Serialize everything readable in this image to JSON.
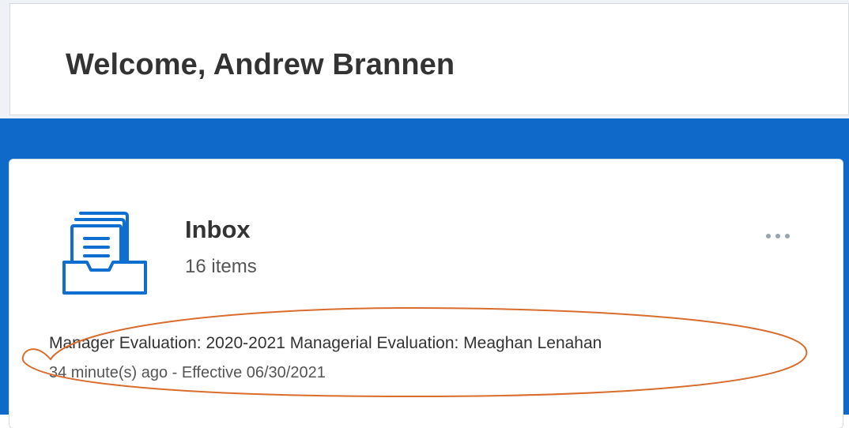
{
  "welcome": {
    "title": "Welcome, Andrew Brannen"
  },
  "inbox": {
    "title": "Inbox",
    "count": "16 items",
    "icon": "inbox-tray-icon",
    "more_icon": "more-horizontal-icon"
  },
  "task": {
    "title": "Manager Evaluation: 2020-2021 Managerial Evaluation: Meaghan Lenahan",
    "meta": "34 minute(s) ago - Effective 06/30/2021"
  },
  "colors": {
    "brand_blue": "#0f69c8",
    "icon_blue": "#0f6fd1",
    "annotation_orange": "#d86d2e",
    "text_dark": "#333333",
    "text_muted": "#555555"
  }
}
